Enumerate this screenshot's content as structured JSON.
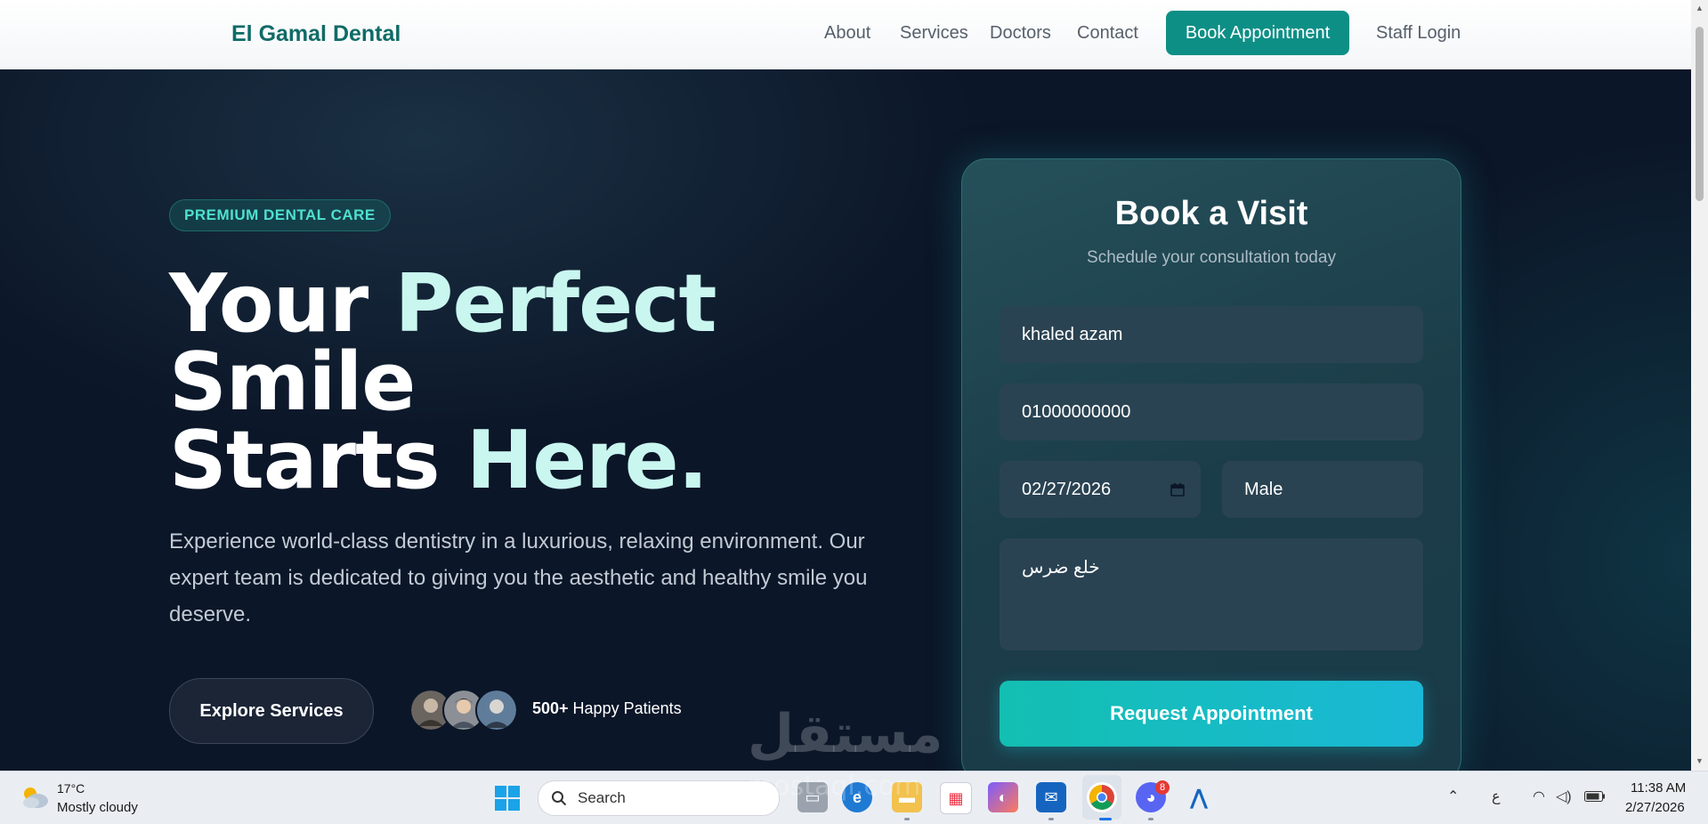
{
  "navbar": {
    "brand": "El Gamal Dental",
    "links": [
      "About",
      "Services",
      "Doctors",
      "Contact"
    ],
    "book_button": "Book Appointment",
    "staff_login": "Staff Login"
  },
  "hero": {
    "badge": "PREMIUM DENTAL CARE",
    "headline": {
      "line1_white": "Your ",
      "line1_accent": "Perfect",
      "line2": "Smile",
      "line3_white": "Starts ",
      "line3_accent": "Here."
    },
    "lead": "Experience world-class dentistry in a luxurious, relaxing environment. Our expert team is dedicated to giving you the aesthetic and healthy smile you deserve.",
    "explore_button": "Explore Services",
    "patients_count": "500+",
    "patients_label": " Happy Patients"
  },
  "booking": {
    "title": "Book a Visit",
    "subtitle": "Schedule your consultation today",
    "name_value": "khaled azam",
    "phone_value": "01000000000",
    "date_value": "02/27/2026",
    "gender_value": "Male",
    "notes_value": "خلع ضرس",
    "submit_button": "Request Appointment"
  },
  "watermark": {
    "arabic": "مستقل",
    "latin": "mostaql.com"
  },
  "taskbar": {
    "weather_temp": "17°C",
    "weather_desc": "Mostly cloudy",
    "search_label": "Search",
    "discord_badge": "8",
    "input_indicator": "ع",
    "time": "11:38 AM",
    "date": "2/27/2026"
  },
  "colors": {
    "brand": "#0f6b66",
    "book_button": "#0e8f86",
    "accent_text": "#c9f6ef",
    "badge_text": "#4fe0cf",
    "submit_gradient": [
      "#13bfb1",
      "#1ab8d6"
    ]
  }
}
